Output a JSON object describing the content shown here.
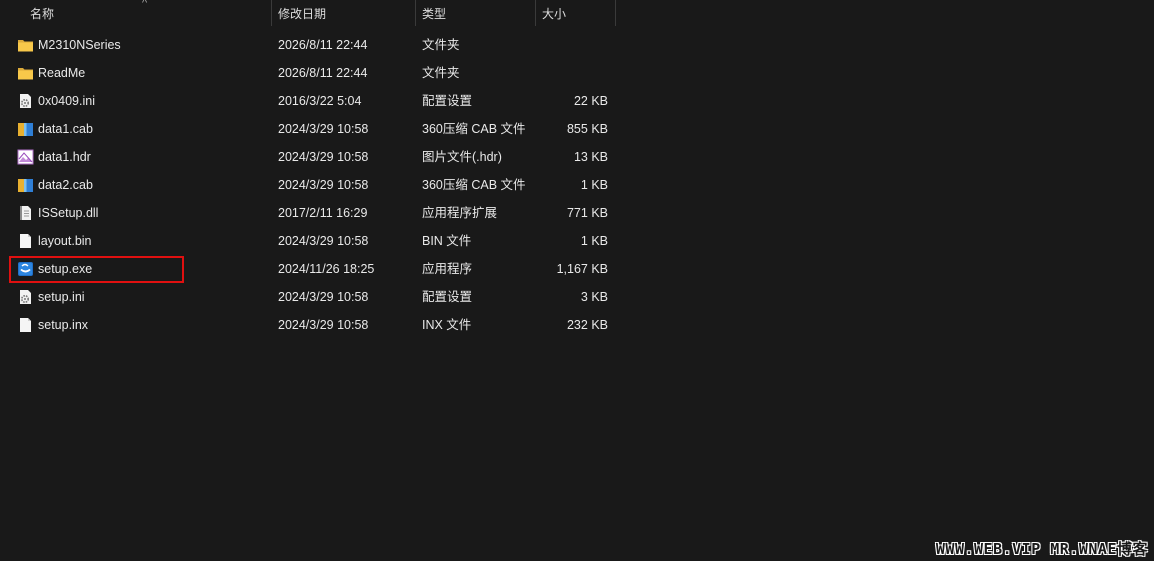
{
  "columns": {
    "name": "名称",
    "date": "修改日期",
    "type": "类型",
    "size": "大小"
  },
  "sort_indicator": "^",
  "files": [
    {
      "name": "M2310NSeries",
      "date": "2026/8/11 22:44",
      "type": "文件夹",
      "size": "",
      "icon": "folder-icon"
    },
    {
      "name": "ReadMe",
      "date": "2026/8/11 22:44",
      "type": "文件夹",
      "size": "",
      "icon": "folder-icon"
    },
    {
      "name": "0x0409.ini",
      "date": "2016/3/22 5:04",
      "type": "配置设置",
      "size": "22 KB",
      "icon": "settings-file-icon"
    },
    {
      "name": "data1.cab",
      "date": "2024/3/29 10:58",
      "type": "360压缩 CAB 文件",
      "size": "855 KB",
      "icon": "archive-icon"
    },
    {
      "name": "data1.hdr",
      "date": "2024/3/29 10:58",
      "type": "图片文件(.hdr)",
      "size": "13 KB",
      "icon": "image-file-icon"
    },
    {
      "name": "data2.cab",
      "date": "2024/3/29 10:58",
      "type": "360压缩 CAB 文件",
      "size": "1 KB",
      "icon": "archive-icon"
    },
    {
      "name": "ISSetup.dll",
      "date": "2017/2/11 16:29",
      "type": "应用程序扩展",
      "size": "771 KB",
      "icon": "dll-file-icon"
    },
    {
      "name": "layout.bin",
      "date": "2024/3/29 10:58",
      "type": "BIN 文件",
      "size": "1 KB",
      "icon": "blank-file-icon"
    },
    {
      "name": "setup.exe",
      "date": "2024/11/26 18:25",
      "type": "应用程序",
      "size": "1,167 KB",
      "icon": "installer-icon"
    },
    {
      "name": "setup.ini",
      "date": "2024/3/29 10:58",
      "type": "配置设置",
      "size": "3 KB",
      "icon": "settings-file-icon"
    },
    {
      "name": "setup.inx",
      "date": "2024/3/29 10:58",
      "type": "INX 文件",
      "size": "232 KB",
      "icon": "blank-file-icon"
    }
  ],
  "highlighted_file": "setup.exe",
  "highlight_color": "#e01010",
  "watermark": "WWW.WEB.VIP  MR.WNAE博客"
}
